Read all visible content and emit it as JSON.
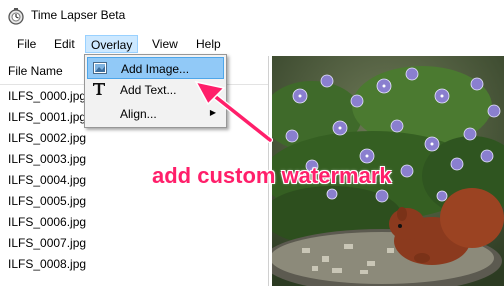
{
  "window": {
    "title": "Time Lapser Beta"
  },
  "menubar": {
    "items": [
      {
        "label": "File"
      },
      {
        "label": "Edit"
      },
      {
        "label": "Overlay"
      },
      {
        "label": "View"
      },
      {
        "label": "Help"
      }
    ]
  },
  "overlay_menu": {
    "items": [
      {
        "label": "Add Image...",
        "icon": "image-icon"
      },
      {
        "label": "Add Text...",
        "icon": "text-icon"
      },
      {
        "label": "Align...",
        "icon": "submenu-arrow-icon"
      }
    ]
  },
  "filelist": {
    "header": "File Name",
    "files": [
      "ILFS_0000.jpg",
      "ILFS_0001.jpg",
      "ILFS_0002.jpg",
      "ILFS_0003.jpg",
      "ILFS_0004.jpg",
      "ILFS_0005.jpg",
      "ILFS_0006.jpg",
      "ILFS_0007.jpg",
      "ILFS_0008.jpg"
    ]
  },
  "annotation": {
    "text": "add custom watermark",
    "color": "#ff1f6a"
  }
}
